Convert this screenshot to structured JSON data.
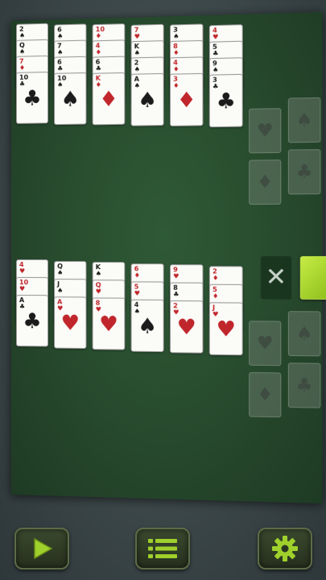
{
  "colors": {
    "felt": "#27492d",
    "card": "#fbfbf8",
    "red_suit": "#c0262b",
    "black_suit": "#1b1b1b",
    "accent_green": "#a5d62e"
  },
  "top_columns": [
    {
      "cards": [
        {
          "rank": "2",
          "suit": "♠",
          "color": "black"
        },
        {
          "rank": "Q",
          "suit": "♠",
          "color": "black"
        },
        {
          "rank": "7",
          "suit": "♦",
          "color": "red"
        },
        {
          "rank": "10",
          "suit": "♣",
          "color": "black"
        }
      ]
    },
    {
      "cards": [
        {
          "rank": "6",
          "suit": "♠",
          "color": "black"
        },
        {
          "rank": "7",
          "suit": "♠",
          "color": "black"
        },
        {
          "rank": "6",
          "suit": "♣",
          "color": "black"
        },
        {
          "rank": "10",
          "suit": "♠",
          "color": "black"
        }
      ]
    },
    {
      "cards": [
        {
          "rank": "10",
          "suit": "♦",
          "color": "red"
        },
        {
          "rank": "4",
          "suit": "♦",
          "color": "red"
        },
        {
          "rank": "6",
          "suit": "♣",
          "color": "black"
        },
        {
          "rank": "K",
          "suit": "♦",
          "color": "red"
        }
      ]
    },
    {
      "cards": [
        {
          "rank": "7",
          "suit": "♥",
          "color": "red"
        },
        {
          "rank": "K",
          "suit": "♠",
          "color": "black"
        },
        {
          "rank": "2",
          "suit": "♠",
          "color": "black"
        },
        {
          "rank": "A",
          "suit": "♠",
          "color": "black"
        }
      ]
    },
    {
      "cards": [
        {
          "rank": "3",
          "suit": "♠",
          "color": "black"
        },
        {
          "rank": "8",
          "suit": "♦",
          "color": "red"
        },
        {
          "rank": "4",
          "suit": "♦",
          "color": "red"
        },
        {
          "rank": "3",
          "suit": "♦",
          "color": "red"
        }
      ]
    },
    {
      "cards": [
        {
          "rank": "4",
          "suit": "♥",
          "color": "red"
        },
        {
          "rank": "5",
          "suit": "♣",
          "color": "black"
        },
        {
          "rank": "9",
          "suit": "♠",
          "color": "black"
        },
        {
          "rank": "3",
          "suit": "♣",
          "color": "black"
        }
      ]
    }
  ],
  "bottom_columns": [
    {
      "cards": [
        {
          "rank": "4",
          "suit": "♥",
          "color": "red"
        },
        {
          "rank": "10",
          "suit": "♥",
          "color": "red"
        },
        {
          "rank": "A",
          "suit": "♣",
          "color": "black"
        }
      ]
    },
    {
      "cards": [
        {
          "rank": "Q",
          "suit": "♠",
          "color": "black"
        },
        {
          "rank": "J",
          "suit": "♠",
          "color": "black"
        },
        {
          "rank": "A",
          "suit": "♥",
          "color": "red"
        }
      ]
    },
    {
      "cards": [
        {
          "rank": "K",
          "suit": "♠",
          "color": "black"
        },
        {
          "rank": "Q",
          "suit": "♥",
          "color": "red"
        },
        {
          "rank": "8",
          "suit": "♥",
          "color": "red"
        }
      ]
    },
    {
      "cards": [
        {
          "rank": "6",
          "suit": "♦",
          "color": "red"
        },
        {
          "rank": "5",
          "suit": "♥",
          "color": "red"
        },
        {
          "rank": "4",
          "suit": "♠",
          "color": "black"
        }
      ]
    },
    {
      "cards": [
        {
          "rank": "9",
          "suit": "♥",
          "color": "red"
        },
        {
          "rank": "8",
          "suit": "♣",
          "color": "black"
        },
        {
          "rank": "2",
          "suit": "♥",
          "color": "red"
        }
      ]
    },
    {
      "cards": [
        {
          "rank": "2",
          "suit": "♦",
          "color": "red"
        },
        {
          "rank": "5",
          "suit": "♦",
          "color": "red"
        },
        {
          "rank": "J",
          "suit": "♥",
          "color": "red"
        }
      ]
    }
  ],
  "top_foundations": [
    "♥",
    "♠",
    "♦",
    "♣"
  ],
  "bottom_foundations": [
    "♥",
    "♠",
    "♦",
    "♣"
  ],
  "stock": {
    "empty_symbol": "✕"
  },
  "toolbar": {
    "play_icon": "play-icon",
    "menu_icon": "menu-icon",
    "settings_icon": "settings-icon"
  }
}
